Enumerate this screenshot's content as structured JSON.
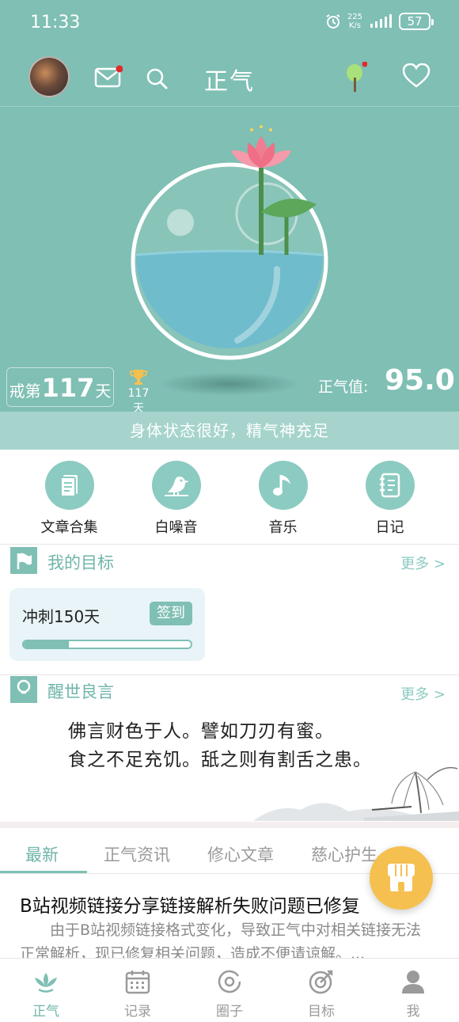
{
  "status_bar": {
    "time": "11:33",
    "net_speed": "225",
    "net_unit": "K/s",
    "battery": "57"
  },
  "header": {
    "title": "正气",
    "icons": [
      "mail-icon",
      "search-icon",
      "tree-icon",
      "heart-icon"
    ]
  },
  "stats": {
    "days_prefix": "戒第",
    "days_number": "117",
    "days_suffix": "天",
    "record_days": "117天",
    "zhengqi_label": "正气值:",
    "zhengqi_value": "95.0",
    "status_message": "身体状态很好，精气神充足"
  },
  "features": [
    {
      "label": "文章合集",
      "icon": "document-icon"
    },
    {
      "label": "白噪音",
      "icon": "bird-icon"
    },
    {
      "label": "音乐",
      "icon": "music-note-icon"
    },
    {
      "label": "日记",
      "icon": "notebook-icon"
    }
  ],
  "goals": {
    "title": "我的目标",
    "more": "更多 >",
    "card": {
      "name": "冲刺150天",
      "checkin_label": "签到",
      "progress": 0.27
    }
  },
  "quotes": {
    "title": "醒世良言",
    "more": "更多 >",
    "lines": [
      "佛言财色于人。譬如刀刃有蜜。",
      "食之不足充饥。舐之则有割舌之患。"
    ]
  },
  "tabs": [
    "最新",
    "正气资讯",
    "修心文章",
    "慈心护生"
  ],
  "article": {
    "title": "B站视频链接分享链接解析失败问题已修复",
    "body": "由于B站视频链接格式变化，导致正气中对相关链接无法正常解析，现已修复相关问题，造成不便请谅解。..."
  },
  "bottom_nav": [
    {
      "label": "正气",
      "icon": "lotus-icon"
    },
    {
      "label": "记录",
      "icon": "calendar-icon"
    },
    {
      "label": "圈子",
      "icon": "circle-icon"
    },
    {
      "label": "目标",
      "icon": "target-icon"
    },
    {
      "label": "我",
      "icon": "person-icon"
    }
  ],
  "colors": {
    "primary": "#7fbfb4",
    "accent_light": "#a6d4cd",
    "fab": "#f5c04f",
    "notification": "#e02a2a"
  }
}
